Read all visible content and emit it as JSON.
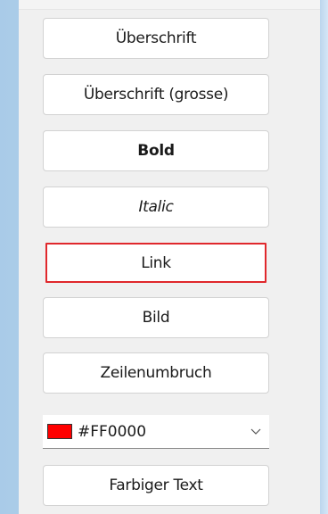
{
  "buttons": {
    "heading": "Überschrift",
    "heading_large": "Überschrift (grosse)",
    "bold": "Bold",
    "italic": "Italic",
    "link": "Link",
    "image": "Bild",
    "line_break": "Zeilenumbruch",
    "colored_text": "Farbiger Text"
  },
  "color_picker": {
    "selected_value": "#FF0000",
    "swatch_color": "#FF0000"
  },
  "state": {
    "focused_button": "link"
  }
}
